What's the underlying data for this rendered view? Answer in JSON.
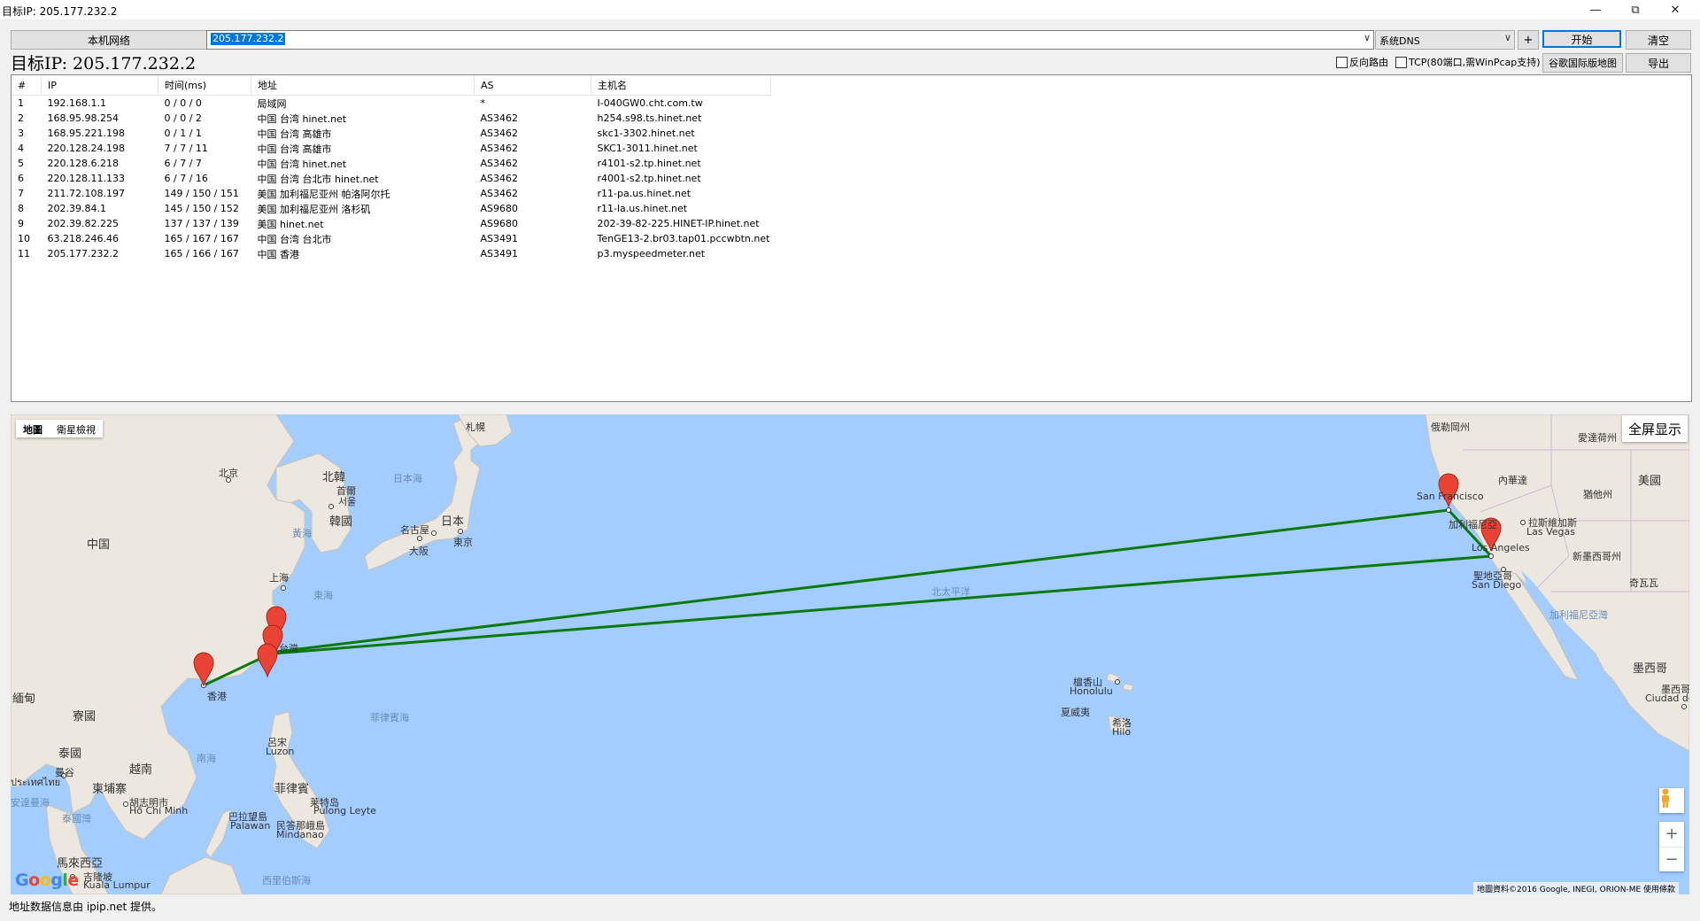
{
  "window": {
    "title": "目标IP: 205.177.232.2"
  },
  "toolbar": {
    "local_network_label": "本机网络",
    "ip_input_value": "205.177.232.2",
    "dns_selected": "系统DNS",
    "plus_label": "+",
    "start_label": "开始",
    "clear_label": "清空",
    "target_label": "目标IP: 205.177.232.2",
    "reverse_route_label": "反向路由",
    "tcp_label": "TCP(80端口,需WinPcap支持)",
    "google_map_label": "谷歌国际版地图",
    "export_label": "导出"
  },
  "table": {
    "headers": [
      "#",
      "IP",
      "时间(ms)",
      "地址",
      "AS",
      "主机名"
    ],
    "rows": [
      [
        "1",
        "192.168.1.1",
        "0 / 0 / 0",
        "局域网",
        "*",
        "I-040GW0.cht.com.tw"
      ],
      [
        "2",
        "168.95.98.254",
        "0 / 0 / 2",
        "中国 台湾 hinet.net",
        "AS3462",
        "h254.s98.ts.hinet.net"
      ],
      [
        "3",
        "168.95.221.198",
        "0 / 1 / 1",
        "中国 台湾 高雄市",
        "AS3462",
        "skc1-3302.hinet.net"
      ],
      [
        "4",
        "220.128.24.198",
        "7 / 7 / 11",
        "中国 台湾 高雄市",
        "AS3462",
        "SKC1-3011.hinet.net"
      ],
      [
        "5",
        "220.128.6.218",
        "6 / 7 / 7",
        "中国 台湾 hinet.net",
        "AS3462",
        "r4101-s2.tp.hinet.net"
      ],
      [
        "6",
        "220.128.11.133",
        "6 / 7 / 16",
        "中国 台湾 台北市 hinet.net",
        "AS3462",
        "r4001-s2.tp.hinet.net"
      ],
      [
        "7",
        "211.72.108.197",
        "149 / 150 / 151",
        "美国 加利福尼亚州 帕洛阿尔托",
        "AS3462",
        "r11-pa.us.hinet.net"
      ],
      [
        "8",
        "202.39.84.1",
        "145 / 150 / 152",
        "美国 加利福尼亚州 洛杉矶",
        "AS9680",
        "r11-la.us.hinet.net"
      ],
      [
        "9",
        "202.39.82.225",
        "137 / 137 / 139",
        "美国 hinet.net",
        "AS9680",
        "202-39-82-225.HINET-IP.hinet.net"
      ],
      [
        "10",
        "63.218.246.46",
        "165 / 167 / 167",
        "中国 台湾 台北市",
        "AS3491",
        "TenGE13-2.br03.tap01.pccwbtn.net"
      ],
      [
        "11",
        "205.177.232.2",
        "165 / 166 / 167",
        "中国 香港",
        "AS3491",
        "p3.myspeedmeter.net"
      ]
    ]
  },
  "map": {
    "type_tabs": [
      "地圖",
      "衛星檢視"
    ],
    "fullscreen_label": "全屏显示",
    "zoom_in_label": "+",
    "zoom_out_label": "−",
    "google_logo": "Google",
    "attribution": "地圖資料©2016 Google, INEGI, ORION-ME   使用條款",
    "route_color": "#0a7a0a",
    "marker_color": "#ea4335",
    "labels": {
      "beijing": "北京",
      "china": "中国",
      "north_korea": "北韓",
      "seoul_zh": "首爾",
      "seoul_ko": "서울",
      "south_korea": "韓國",
      "sea_of_japan": "日本海",
      "sapporo": "札幌",
      "japan": "日本",
      "nagoya": "名古屋",
      "tokyo": "東京",
      "osaka": "大阪",
      "yellow_sea": "黃海",
      "shanghai": "上海",
      "east_china_sea": "東海",
      "hong_kong": "香港",
      "philippine_sea": "菲律賓海",
      "south_china_sea": "南海",
      "luzon_zh": "呂宋",
      "luzon_en": "Luzon",
      "philippines": "菲律賓",
      "vietnam": "越南",
      "laos": "寮國",
      "thailand": "泰國",
      "myanmar": "緬甸",
      "cambodia": "柬埔寨",
      "hcm_zh": "胡志明市",
      "hcm_en": "Hồ Chí Minh",
      "bangkok": "曼谷",
      "thai_script": "ประเทศไทย",
      "palawan_zh": "巴拉望島",
      "palawan_en": "Palawan",
      "mindanao_zh": "民答那峨島",
      "mindanao_en": "Mindanao",
      "pulog_zh": "莱特岛",
      "pulog_en": "Pulong Leyte",
      "andaman": "安達曼海",
      "gulf_thailand": "泰國灣",
      "malaysia": "馬來西亞",
      "kl_zh": "吉隆坡",
      "kl_en": "Kuala Lumpur",
      "celebes": "西里伯斯海",
      "taiwan": "台灣",
      "north_pacific": "北太平洋",
      "honolulu_zh": "檀香山",
      "honolulu_en": "Honolulu",
      "hawaii": "夏威夷",
      "hilo_zh": "希洛",
      "hilo_en": "Hilo",
      "sf": "San Francisco",
      "la": "Los Angeles",
      "sd_zh": "聖地亞哥",
      "sd_en": "San Diego",
      "lv_zh": "拉斯維加斯",
      "lv_en": "Las Vegas",
      "usa": "美國",
      "mexico": "墨西哥",
      "mexico_city_zh": "墨西哥城",
      "mexico_city_en": "Ciudad de México",
      "nevada": "內華達",
      "oregon": "俄勒岡州",
      "idaho": "愛達荷州",
      "southwest": "新墨西哥州",
      "gulf_ca": "加利福尼亞灣",
      "california": "加利福尼亞",
      "sonora": "奇瓦瓦",
      "utah": "猶他州"
    }
  },
  "status": {
    "text": "地址数据信息由 ipip.net 提供。"
  }
}
